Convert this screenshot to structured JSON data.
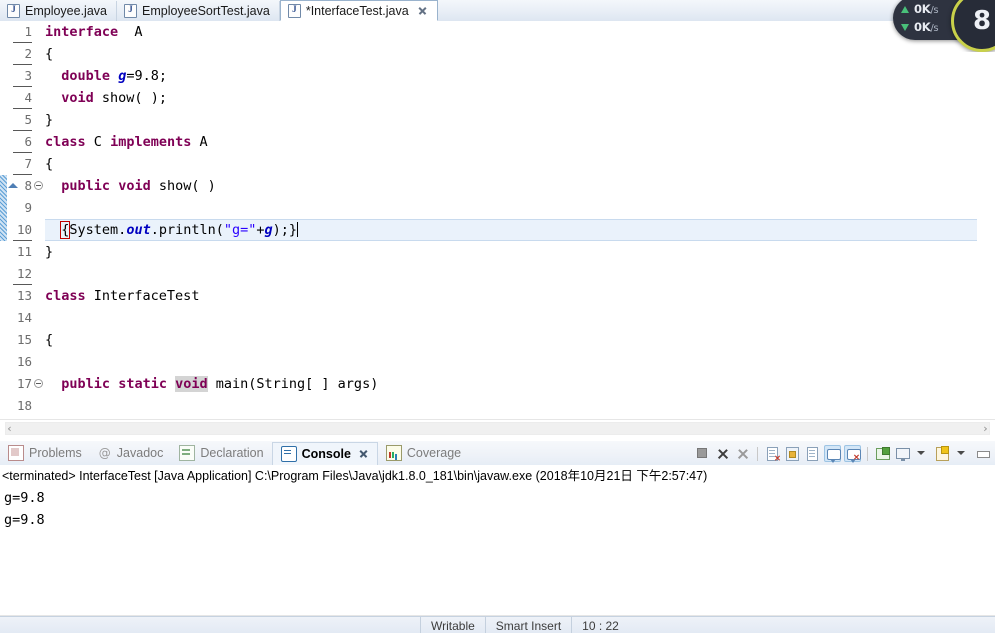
{
  "editor_tabs": [
    {
      "label": "Employee.java",
      "active": false,
      "dirty": false,
      "closable": false
    },
    {
      "label": "EmployeeSortTest.java",
      "active": false,
      "dirty": false,
      "closable": false
    },
    {
      "label": "*InterfaceTest.java",
      "active": true,
      "dirty": true,
      "closable": true
    }
  ],
  "code": {
    "lines": [
      {
        "num": "1",
        "fold": false,
        "changed": false
      },
      {
        "num": "2",
        "fold": false,
        "changed": false
      },
      {
        "num": "3",
        "fold": false,
        "changed": false
      },
      {
        "num": "4",
        "fold": false,
        "changed": false
      },
      {
        "num": "5",
        "fold": false,
        "changed": false
      },
      {
        "num": "6",
        "fold": false,
        "changed": false
      },
      {
        "num": "7",
        "fold": false,
        "changed": false
      },
      {
        "num": "8",
        "fold": true,
        "changed": true
      },
      {
        "num": "9",
        "fold": false,
        "changed": true
      },
      {
        "num": "10",
        "fold": false,
        "changed": true
      },
      {
        "num": "11",
        "fold": false,
        "changed": false
      },
      {
        "num": "12",
        "fold": false,
        "changed": false
      },
      {
        "num": "13",
        "fold": false,
        "changed": false
      },
      {
        "num": "14",
        "fold": false,
        "changed": false
      },
      {
        "num": "15",
        "fold": false,
        "changed": false
      },
      {
        "num": "16",
        "fold": false,
        "changed": false
      },
      {
        "num": "17",
        "fold": true,
        "changed": false
      },
      {
        "num": "18",
        "fold": false,
        "changed": false
      }
    ],
    "text": {
      "l1_kw": "interface",
      "l1_name": "A",
      "l2": "{",
      "l3_kw": "double",
      "l3_field": "g",
      "l3_rest": "=9.8;",
      "l4_kw": "void",
      "l4_rest": "show( );",
      "l5": "}",
      "l6_kw1": "class",
      "l6_name": "C",
      "l6_kw2": "implements",
      "l6_iface": "A",
      "l7": "{",
      "l8_kw1": "public",
      "l8_kw2": "void",
      "l8_rest": "show( )",
      "l10_brace": "{",
      "l10_a": "System.",
      "l10_out": "out",
      "l10_b": ".println(",
      "l10_str": "\"g=\"",
      "l10_plus": "+",
      "l10_g": "g",
      "l10_c": ");}",
      "l11": "}",
      "l13_kw": "class",
      "l13_name": "InterfaceTest",
      "l15": "{",
      "l17_kw1": "public",
      "l17_kw2": "static",
      "l17_kw3": "void",
      "l17_rest": "main(String[ ] args)"
    },
    "highlighted_line": "10",
    "caret_line": "10"
  },
  "panel": {
    "tabs": [
      {
        "label": "Problems",
        "icon": "problems-icon",
        "active": false,
        "closable": false
      },
      {
        "label": "Javadoc",
        "icon": "javadoc-icon",
        "active": false,
        "closable": false
      },
      {
        "label": "Declaration",
        "icon": "declaration-icon",
        "active": false,
        "closable": false
      },
      {
        "label": "Console",
        "icon": "console-icon",
        "active": true,
        "closable": true
      },
      {
        "label": "Coverage",
        "icon": "coverage-icon",
        "active": false,
        "closable": false
      }
    ],
    "toolbar": [
      {
        "name": "terminate-button",
        "state": "off"
      },
      {
        "name": "remove-launch-button",
        "state": "off"
      },
      {
        "name": "remove-all-terminated-button",
        "state": "off"
      },
      {
        "name": "separator",
        "state": "off"
      },
      {
        "name": "clear-console-button",
        "state": "off"
      },
      {
        "name": "scroll-lock-button",
        "state": "off"
      },
      {
        "name": "word-wrap-button",
        "state": "off"
      },
      {
        "name": "show-console-on-output-button",
        "state": "on"
      },
      {
        "name": "show-console-on-error-button",
        "state": "on"
      },
      {
        "name": "separator",
        "state": "off"
      },
      {
        "name": "pin-console-button",
        "state": "off"
      },
      {
        "name": "display-selected-console-button",
        "state": "off"
      },
      {
        "name": "display-selected-console-dropdown",
        "state": "off"
      },
      {
        "name": "open-console-button",
        "state": "off"
      },
      {
        "name": "open-console-dropdown",
        "state": "off"
      },
      {
        "name": "minimize-button",
        "state": "off"
      }
    ],
    "status_line": "<terminated> InterfaceTest [Java Application] C:\\Program Files\\Java\\jdk1.8.0_181\\bin\\javaw.exe (2018年10月21日 下午2:57:47)",
    "output": [
      "g=9.8",
      "g=9.8"
    ]
  },
  "status_bar": {
    "writable": "Writable",
    "insert_mode": "Smart Insert",
    "position": "10 : 22"
  },
  "net_widget": {
    "upload": "0K",
    "upload_unit": "/s",
    "download": "0K",
    "download_unit": "/s",
    "gauge_value": "8"
  },
  "colors": {
    "keyword": "#7f0055",
    "field": "#0000c0",
    "string": "#2a00ff",
    "highlight_line": "#eaf2fb",
    "occurrence": "#d4d4d4",
    "bracket_match": "#c00000"
  }
}
